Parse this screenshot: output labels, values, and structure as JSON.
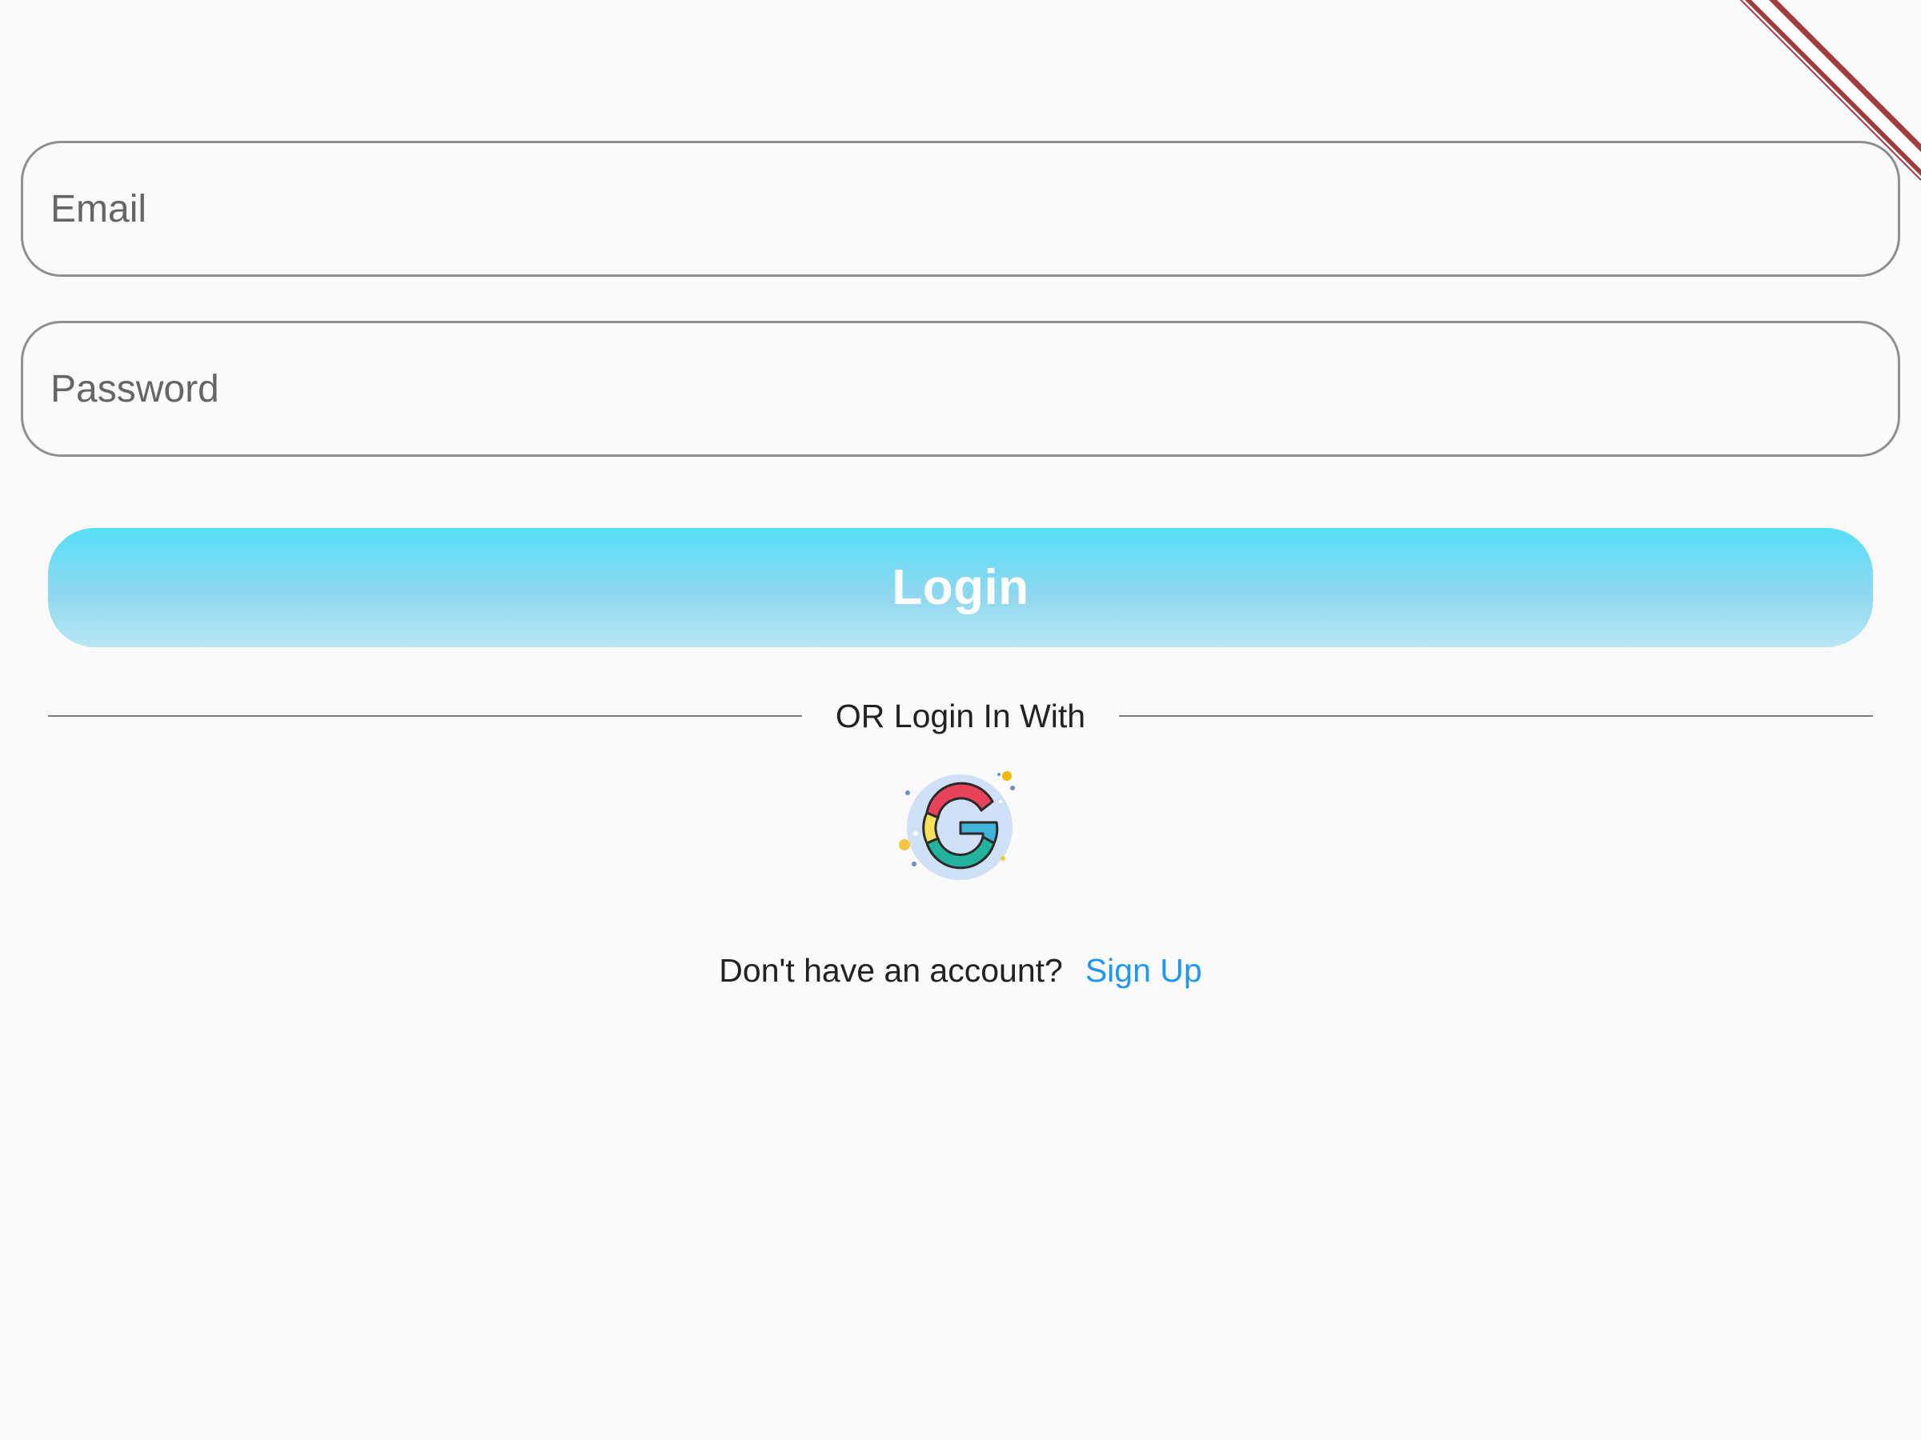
{
  "debug_banner": {
    "icon": "debug-ribbon",
    "color": "#a13c3c"
  },
  "form": {
    "email_placeholder": "Email",
    "password_placeholder": "Password",
    "login_label": "Login"
  },
  "divider": {
    "text": "OR Login In With"
  },
  "social": {
    "google_icon": "google-icon"
  },
  "signup": {
    "prompt": "Don't have an account?",
    "link": "Sign Up",
    "link_color": "#2196f3"
  },
  "colors": {
    "background": "#fafafa",
    "button_gradient_top": "#57def7",
    "button_gradient_bottom": "#b9e8f5",
    "field_border": "#8f8f8f"
  }
}
